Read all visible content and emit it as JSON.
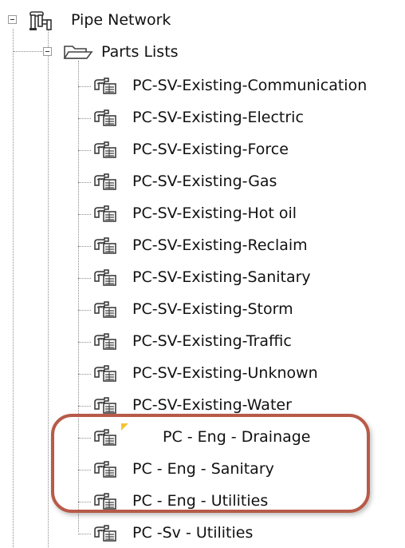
{
  "tree": {
    "pipe_network": {
      "label": "Pipe Network",
      "icon": "pipe-network-icon"
    },
    "parts_lists": {
      "label": "Parts Lists",
      "icon": "open-folder-icon"
    },
    "items": [
      {
        "label": "PC-SV-Existing-Communication",
        "icon": "parts-list-icon"
      },
      {
        "label": "PC-SV-Existing-Electric",
        "icon": "parts-list-icon"
      },
      {
        "label": "PC-SV-Existing-Force",
        "icon": "parts-list-icon"
      },
      {
        "label": "PC-SV-Existing-Gas",
        "icon": "parts-list-icon"
      },
      {
        "label": "PC-SV-Existing-Hot oil",
        "icon": "parts-list-icon"
      },
      {
        "label": "PC-SV-Existing-Reclaim",
        "icon": "parts-list-icon"
      },
      {
        "label": "PC-SV-Existing-Sanitary",
        "icon": "parts-list-icon"
      },
      {
        "label": "PC-SV-Existing-Storm",
        "icon": "parts-list-icon"
      },
      {
        "label": "PC-SV-Existing-Traffic",
        "icon": "parts-list-icon"
      },
      {
        "label": "PC-SV-Existing-Unknown",
        "icon": "parts-list-icon"
      },
      {
        "label": "PC-SV-Existing-Water",
        "icon": "parts-list-icon"
      },
      {
        "label": "PC - Eng - Drainage",
        "icon": "parts-list-icon"
      },
      {
        "label": "PC - Eng - Sanitary",
        "icon": "parts-list-icon"
      },
      {
        "label": "PC - Eng - Utilities",
        "icon": "parts-list-icon"
      },
      {
        "label": "PC -Sv - Utilities",
        "icon": "parts-list-icon"
      }
    ]
  },
  "colors": {
    "highlight_border": "#b85a48",
    "warning_flag": "#f4c430",
    "tree_lines": "#8c8c8c"
  }
}
